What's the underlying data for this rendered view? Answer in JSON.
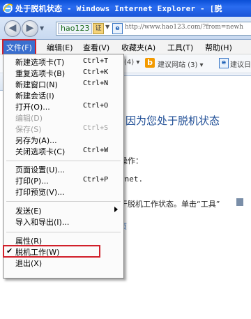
{
  "window": {
    "title": "处于脱机状态 - Windows Internet Explorer - [脱"
  },
  "address_bar": {
    "site_label": "hao123",
    "cert_glyph": "证",
    "page_glyph": "e",
    "url": "http://www.hao123.com/?from=newh"
  },
  "menubar": {
    "items": [
      "文件(F)",
      "编辑(E)",
      "查看(V)",
      "收藏夹(A)",
      "工具(T)",
      "帮助(H)"
    ]
  },
  "favorites_bar": {
    "fav_count": "(4) ▾",
    "link1": "建议网站 (3) ▾",
    "link2": "建议日"
  },
  "content": {
    "heading": "用，因为您处于脱机状态",
    "line1": "操作：",
    "line2": "rnet.",
    "line3": "于脱机工作状态。单击“工具”",
    "line4": "页"
  },
  "file_menu": {
    "items": [
      {
        "label": "新建选项卡(T)",
        "shortcut": "Ctrl+T"
      },
      {
        "label": "重复选项卡(B)",
        "shortcut": "Ctrl+K"
      },
      {
        "label": "新建窗口(N)",
        "shortcut": "Ctrl+N"
      },
      {
        "label": "新建会话(I)",
        "shortcut": ""
      },
      {
        "label": "打开(O)...",
        "shortcut": "Ctrl+O"
      },
      {
        "label": "编辑(D)",
        "shortcut": ""
      },
      {
        "label": "保存(S)",
        "shortcut": "Ctrl+S"
      },
      {
        "label": "另存为(A)...",
        "shortcut": ""
      },
      {
        "label": "关闭选项卡(C)",
        "shortcut": "Ctrl+W"
      },
      {
        "label": "页面设置(U)...",
        "shortcut": ""
      },
      {
        "label": "打印(P)...",
        "shortcut": "Ctrl+P"
      },
      {
        "label": "打印预览(V)...",
        "shortcut": ""
      },
      {
        "label": "发送(E)",
        "shortcut": ""
      },
      {
        "label": "导入和导出(I)...",
        "shortcut": ""
      },
      {
        "label": "属性(R)",
        "shortcut": ""
      },
      {
        "label": "脱机工作(W)",
        "shortcut": ""
      },
      {
        "label": "退出(X)",
        "shortcut": ""
      }
    ],
    "check_glyph": "✔"
  },
  "colors": {
    "highlight_box": "#d1202a",
    "title_bar": "#0a4fd6",
    "menu_active": "#3a6fcf"
  }
}
